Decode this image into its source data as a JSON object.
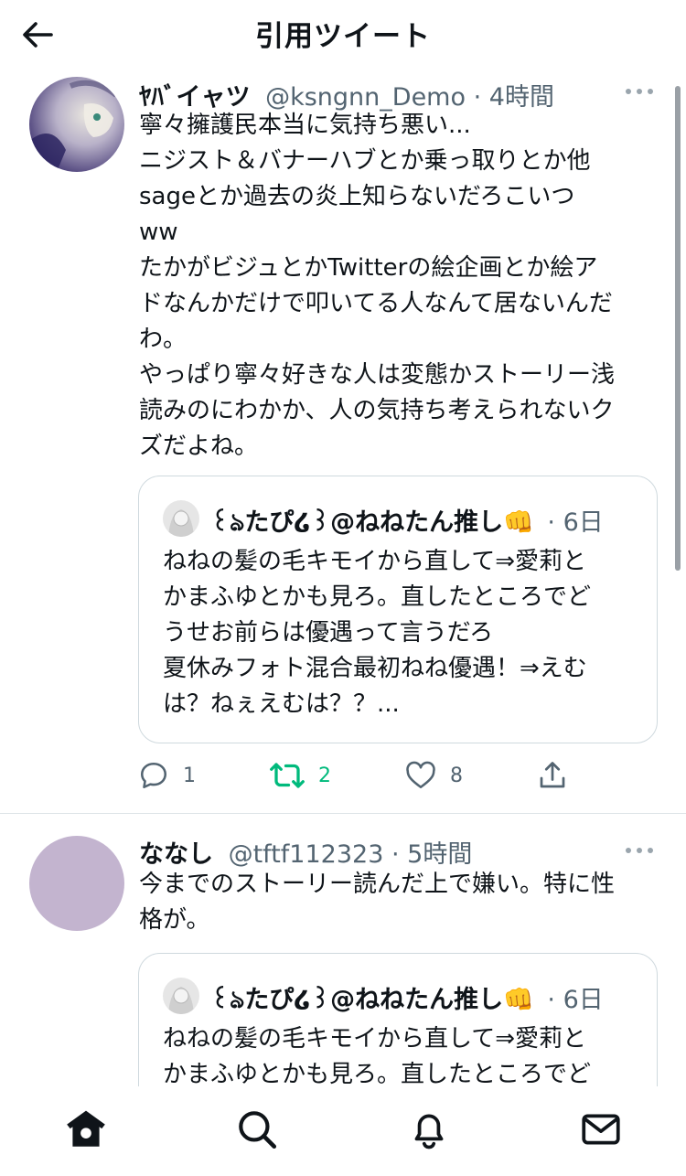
{
  "header": {
    "title": "引用ツイート",
    "back_icon": "arrow-left-icon"
  },
  "tweets": [
    {
      "name": "ﾔﾊﾞイャツ",
      "handle": "@ksngnn_Demo",
      "time": "4時間",
      "text": "寧々擁護民本当に気持ち悪い...\nニジスト＆バナーハブとか乗っ取りとか他\nsageとか過去の炎上知らないだろこいつ\nww\nたかがビジュとかTwitterの絵企画とか絵ア\nドなんかだけで叩いてる人なんて居ないんだ\nわ。\nやっぱり寧々好きな人は変態かストーリー浅\n読みのにわかか、人の気持ち考えられないク\nズだよね。",
      "quote": {
        "name": "꒰ঌたぴ໒꒱@ねねたん推し👊",
        "time": "6日",
        "text": "ねねの髪の毛キモイから直して⇒愛莉と\nかまふゆとかも見ろ。直したところでど\nうせお前らは優遇って言うだろ\n夏休みフォト混合最初ねね優遇！⇒えむ\nは？ねぇえむは？？..."
      },
      "actions": {
        "reply": "1",
        "retweet": "2",
        "like": "8"
      }
    },
    {
      "name": "ななし",
      "handle": "@tftf112323",
      "time": "5時間",
      "text": "今までのストーリー読んだ上で嫌い。特に性\n格が。",
      "quote": {
        "name": "꒰ঌたぴ໒꒱@ねねたん推し👊",
        "time": "6日",
        "text": "ねねの髪の毛キモイから直して⇒愛莉と\nかまふゆとかも見ろ。直したところでど"
      }
    }
  ],
  "separator": "·",
  "bottom_nav": [
    "home-icon",
    "search-icon",
    "notifications-icon",
    "messages-icon"
  ],
  "colors": {
    "text": "#0f1419",
    "secondary": "#536471",
    "retweet_active": "#00ba7c",
    "border": "#cfd9de"
  }
}
